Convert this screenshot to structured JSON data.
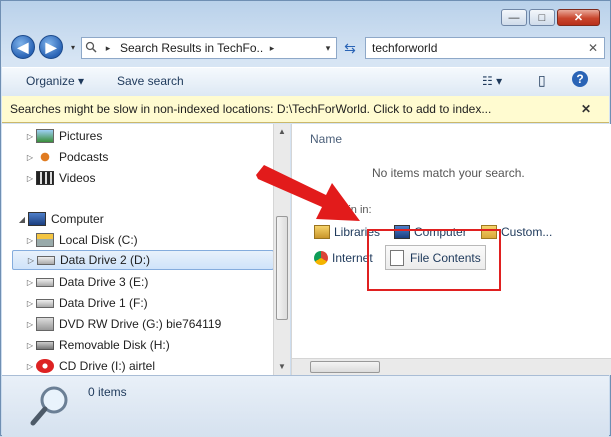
{
  "titlebar": {
    "minimize": "—",
    "maximize": "□",
    "close": "✕"
  },
  "nav": {
    "back_icon": "back-arrow-icon",
    "forward_icon": "forward-arrow-icon",
    "dropdown": "▾",
    "address_text": "Search Results in TechFo...",
    "address_arrow": "▸",
    "address_dropdown": "▾",
    "refresh": "⇆",
    "search_value": "techforworld",
    "search_clear": "✕"
  },
  "commandbar": {
    "organize": "Organize ▾",
    "save_search": "Save search",
    "views": "☷ ▾",
    "preview": "▯",
    "help": "?"
  },
  "infobar": {
    "text": "Searches might be slow in non-indexed locations: D:\\TechForWorld. Click to add to index...",
    "close": "✕"
  },
  "tree": {
    "items": [
      {
        "label": "Pictures",
        "icon": "pictures-icon"
      },
      {
        "label": "Podcasts",
        "icon": "podcasts-icon"
      },
      {
        "label": "Videos",
        "icon": "videos-icon"
      },
      {
        "label": "Computer",
        "icon": "computer-icon"
      },
      {
        "label": "Local Disk (C:)",
        "icon": "local-disk-icon"
      },
      {
        "label": "Data Drive 2 (D:)",
        "icon": "drive-icon"
      },
      {
        "label": "Data Drive 3 (E:)",
        "icon": "drive-icon"
      },
      {
        "label": "Data Drive 1 (F:)",
        "icon": "drive-icon"
      },
      {
        "label": "DVD RW Drive (G:) bie764119",
        "icon": "dvd-drive-icon"
      },
      {
        "label": "Removable Disk (H:)",
        "icon": "removable-disk-icon"
      },
      {
        "label": "CD Drive (I:) airtel",
        "icon": "cd-drive-icon"
      }
    ]
  },
  "results": {
    "column_name": "Name",
    "empty_text": "No items match your search.",
    "search_again_label": "again in:",
    "targets": {
      "libraries": "Libraries",
      "computer": "Computer",
      "custom": "Custom...",
      "internet": "Internet",
      "file_contents": "File Contents"
    }
  },
  "status": {
    "count": "0 items"
  }
}
